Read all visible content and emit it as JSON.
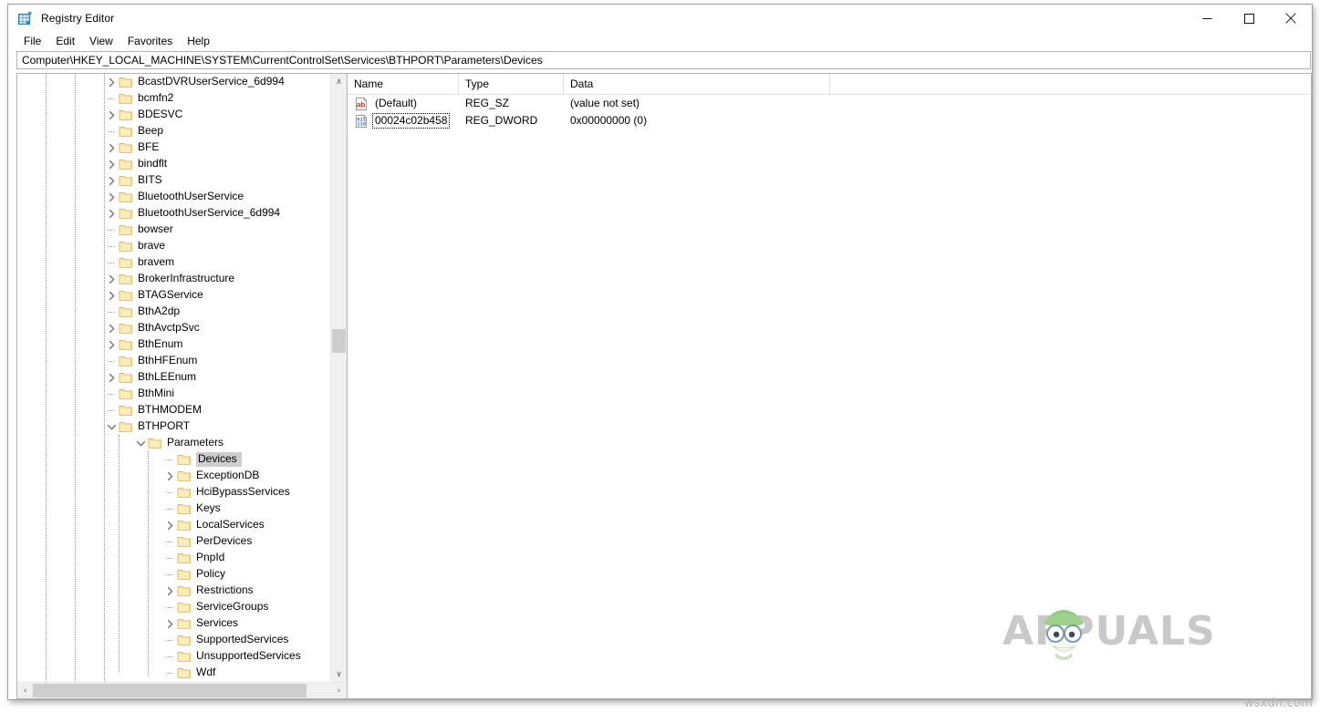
{
  "window": {
    "title": "Registry Editor",
    "icon": "registry-editor-icon",
    "controls": {
      "minimize": "—",
      "maximize": "☐",
      "close": "✕"
    }
  },
  "menubar": {
    "items": [
      "File",
      "Edit",
      "View",
      "Favorites",
      "Help"
    ]
  },
  "address": {
    "path": "Computer\\HKEY_LOCAL_MACHINE\\SYSTEM\\CurrentControlSet\\Services\\BTHPORT\\Parameters\\Devices"
  },
  "tree": {
    "selected": "Devices",
    "nodes": [
      {
        "label": "BcastDVRUserService_6d994",
        "depth": 3,
        "state": "collapsed"
      },
      {
        "label": "bcmfn2",
        "depth": 3,
        "state": "leaf"
      },
      {
        "label": "BDESVC",
        "depth": 3,
        "state": "collapsed"
      },
      {
        "label": "Beep",
        "depth": 3,
        "state": "leaf"
      },
      {
        "label": "BFE",
        "depth": 3,
        "state": "collapsed"
      },
      {
        "label": "bindflt",
        "depth": 3,
        "state": "collapsed"
      },
      {
        "label": "BITS",
        "depth": 3,
        "state": "collapsed"
      },
      {
        "label": "BluetoothUserService",
        "depth": 3,
        "state": "collapsed"
      },
      {
        "label": "BluetoothUserService_6d994",
        "depth": 3,
        "state": "collapsed"
      },
      {
        "label": "bowser",
        "depth": 3,
        "state": "leaf"
      },
      {
        "label": "brave",
        "depth": 3,
        "state": "leaf"
      },
      {
        "label": "bravem",
        "depth": 3,
        "state": "leaf"
      },
      {
        "label": "BrokerInfrastructure",
        "depth": 3,
        "state": "collapsed"
      },
      {
        "label": "BTAGService",
        "depth": 3,
        "state": "collapsed"
      },
      {
        "label": "BthA2dp",
        "depth": 3,
        "state": "leaf"
      },
      {
        "label": "BthAvctpSvc",
        "depth": 3,
        "state": "collapsed"
      },
      {
        "label": "BthEnum",
        "depth": 3,
        "state": "collapsed"
      },
      {
        "label": "BthHFEnum",
        "depth": 3,
        "state": "leaf"
      },
      {
        "label": "BthLEEnum",
        "depth": 3,
        "state": "collapsed"
      },
      {
        "label": "BthMini",
        "depth": 3,
        "state": "leaf"
      },
      {
        "label": "BTHMODEM",
        "depth": 3,
        "state": "leaf"
      },
      {
        "label": "BTHPORT",
        "depth": 3,
        "state": "expanded"
      },
      {
        "label": "Parameters",
        "depth": 4,
        "state": "expanded"
      },
      {
        "label": "Devices",
        "depth": 5,
        "state": "leaf",
        "selected": true
      },
      {
        "label": "ExceptionDB",
        "depth": 5,
        "state": "collapsed"
      },
      {
        "label": "HciBypassServices",
        "depth": 5,
        "state": "leaf"
      },
      {
        "label": "Keys",
        "depth": 5,
        "state": "leaf"
      },
      {
        "label": "LocalServices",
        "depth": 5,
        "state": "collapsed"
      },
      {
        "label": "PerDevices",
        "depth": 5,
        "state": "leaf"
      },
      {
        "label": "PnpId",
        "depth": 5,
        "state": "leaf"
      },
      {
        "label": "Policy",
        "depth": 5,
        "state": "leaf"
      },
      {
        "label": "Restrictions",
        "depth": 5,
        "state": "collapsed"
      },
      {
        "label": "ServiceGroups",
        "depth": 5,
        "state": "leaf"
      },
      {
        "label": "Services",
        "depth": 5,
        "state": "collapsed"
      },
      {
        "label": "SupportedServices",
        "depth": 5,
        "state": "leaf"
      },
      {
        "label": "UnsupportedServices",
        "depth": 5,
        "state": "leaf"
      },
      {
        "label": "Wdf",
        "depth": 5,
        "state": "leaf"
      }
    ]
  },
  "values": {
    "columns": [
      "Name",
      "Type",
      "Data"
    ],
    "rows": [
      {
        "icon": "string-value-icon",
        "name": "(Default)",
        "type": "REG_SZ",
        "data": "(value not set)",
        "focused": false
      },
      {
        "icon": "dword-value-icon",
        "name": "00024c02b458",
        "type": "REG_DWORD",
        "data": "0x00000000 (0)",
        "focused": true
      }
    ]
  },
  "scrollbars": {
    "tree_vertical": {
      "up_arrow": "∧",
      "down_arrow": "∨"
    },
    "tree_horizontal": {
      "left_arrow": "‹",
      "right_arrow": "›"
    }
  },
  "watermark": {
    "brand": "APPUALS",
    "site": "wsxdn.com"
  }
}
